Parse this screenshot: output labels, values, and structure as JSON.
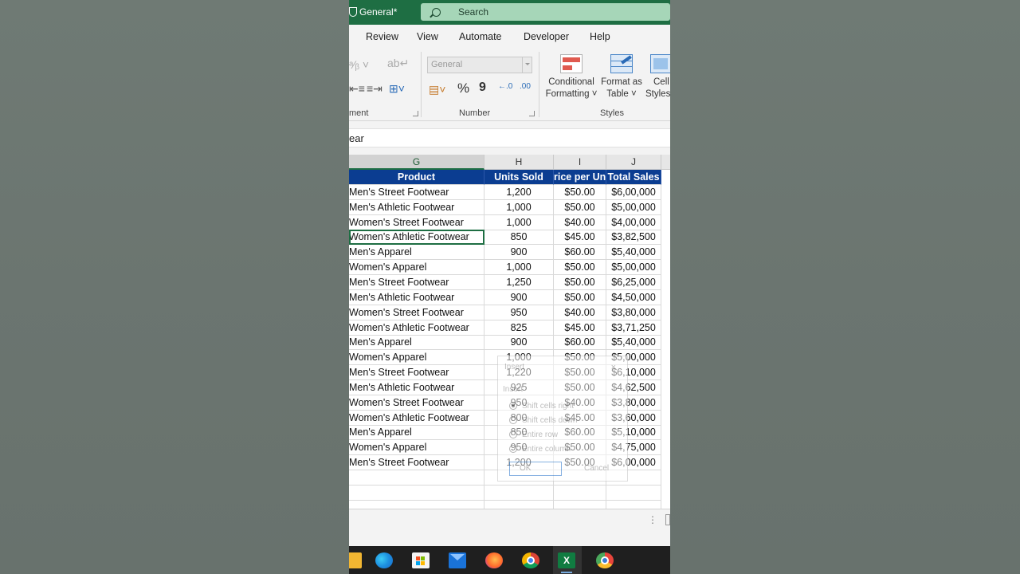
{
  "titlebar": {
    "title": "General*",
    "search_label": "Search",
    "bg": "#1e6e43"
  },
  "menu": {
    "tabs": [
      "Review",
      "View",
      "Automate",
      "Developer",
      "Help"
    ]
  },
  "ribbon": {
    "alignment_label": "ment",
    "number_label": "Number",
    "styles_label": "Styles",
    "number_format": "General",
    "percent": "%",
    "comma": "9",
    "inc_decimal": "←.0",
    "dec_decimal": ".00",
    "cond_fmt": [
      "Conditional",
      "Formatting ˅"
    ],
    "fmt_table": [
      "Format as",
      "Table ˅"
    ],
    "cell_styles": [
      "Cell",
      "Styles"
    ]
  },
  "formula_bar": {
    "value": "ear"
  },
  "columns": [
    {
      "id": "G",
      "selected": true
    },
    {
      "id": "H",
      "selected": false
    },
    {
      "id": "I",
      "selected": false
    },
    {
      "id": "J",
      "selected": false
    }
  ],
  "table": {
    "headers": [
      "Product",
      "Units Sold",
      "rice per Un",
      "Total Sales"
    ],
    "header_bg": "#0b3d91",
    "rows": [
      [
        "Men's Street Footwear",
        "1,200",
        "$50.00",
        "$6,00,000"
      ],
      [
        "Men's Athletic Footwear",
        "1,000",
        "$50.00",
        "$5,00,000"
      ],
      [
        "Women's Street Footwear",
        "1,000",
        "$40.00",
        "$4,00,000"
      ],
      [
        "Women's Athletic Footwear",
        "850",
        "$45.00",
        "$3,82,500"
      ],
      [
        "Men's Apparel",
        "900",
        "$60.00",
        "$5,40,000"
      ],
      [
        "Women's Apparel",
        "1,000",
        "$50.00",
        "$5,00,000"
      ],
      [
        "Men's Street Footwear",
        "1,250",
        "$50.00",
        "$6,25,000"
      ],
      [
        "Men's Athletic Footwear",
        "900",
        "$50.00",
        "$4,50,000"
      ],
      [
        "Women's Street Footwear",
        "950",
        "$40.00",
        "$3,80,000"
      ],
      [
        "Women's Athletic Footwear",
        "825",
        "$45.00",
        "$3,71,250"
      ],
      [
        "Men's Apparel",
        "900",
        "$60.00",
        "$5,40,000"
      ],
      [
        "Women's Apparel",
        "1,000",
        "$50.00",
        "$5,00,000"
      ],
      [
        "Men's Street Footwear",
        "1,220",
        "$50.00",
        "$6,10,000"
      ],
      [
        "Men's Athletic Footwear",
        "925",
        "$50.00",
        "$4,62,500"
      ],
      [
        "Women's Street Footwear",
        "950",
        "$40.00",
        "$3,80,000"
      ],
      [
        "Women's Athletic Footwear",
        "800",
        "$45.00",
        "$3,60,000"
      ],
      [
        "Men's Apparel",
        "850",
        "$60.00",
        "$5,10,000"
      ],
      [
        "Women's Apparel",
        "950",
        "$50.00",
        "$4,75,000"
      ],
      [
        "Men's Street Footwear",
        "1,200",
        "$50.00",
        "$6,00,000"
      ]
    ]
  },
  "insert_dialog": {
    "title": "Insert",
    "section": "Insert",
    "close": "×",
    "options": [
      "Shift cells right",
      "Shift cells down",
      "Entire row",
      "Entire column"
    ],
    "ok": "OK",
    "cancel": "Cancel"
  },
  "sheetbar": {
    "dots": "⋮"
  },
  "taskbar": {
    "excel_glyph": "X"
  }
}
